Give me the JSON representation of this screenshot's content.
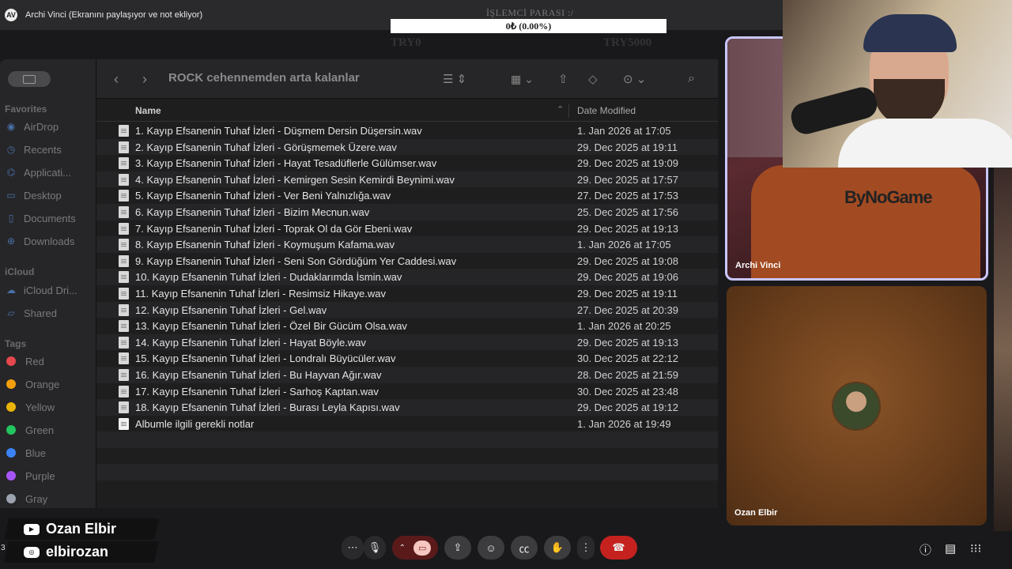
{
  "meeting": {
    "share_banner": "Archi Vinci (Ekranını paylaşıyor ve not ekliyor)",
    "logo_text": "AV"
  },
  "counter": {
    "title": "İŞLEMCİ PARASI :/",
    "value": "0₺ (0.00%)",
    "min": "TRY0",
    "max": "TRY5000"
  },
  "finder": {
    "title": "ROCK cehennemden arta kalanlar",
    "columns": {
      "name": "Name",
      "date": "Date Modified"
    },
    "sidebar": {
      "favorites_label": "Favorites",
      "favorites": [
        {
          "label": "AirDrop",
          "icon": "airdrop-icon"
        },
        {
          "label": "Recents",
          "icon": "clock-icon"
        },
        {
          "label": "Applicati...",
          "icon": "applications-icon"
        },
        {
          "label": "Desktop",
          "icon": "desktop-icon"
        },
        {
          "label": "Documents",
          "icon": "document-icon"
        },
        {
          "label": "Downloads",
          "icon": "download-icon"
        }
      ],
      "icloud_label": "iCloud",
      "icloud": [
        {
          "label": "iCloud Dri...",
          "icon": "cloud-icon"
        },
        {
          "label": "Shared",
          "icon": "shared-folder-icon"
        }
      ],
      "tags_label": "Tags",
      "tags": [
        {
          "label": "Red",
          "color": "#e5484d"
        },
        {
          "label": "Orange",
          "color": "#f59e0b"
        },
        {
          "label": "Yellow",
          "color": "#eab308"
        },
        {
          "label": "Green",
          "color": "#22c55e"
        },
        {
          "label": "Blue",
          "color": "#3b82f6"
        },
        {
          "label": "Purple",
          "color": "#a855f7"
        },
        {
          "label": "Gray",
          "color": "#9ca3af"
        }
      ]
    },
    "files": [
      {
        "name": "1. Kayıp Efsanenin Tuhaf İzleri - Düşmem Dersin Düşersin.wav",
        "date": "1. Jan 2026 at 17:05"
      },
      {
        "name": "2. Kayıp Efsanenin Tuhaf İzleri - Görüşmemek Üzere.wav",
        "date": "29. Dec 2025 at 19:11"
      },
      {
        "name": "3. Kayıp Efsanenin Tuhaf İzleri - Hayat Tesadüflerle Gülümser.wav",
        "date": "29. Dec 2025 at 19:09"
      },
      {
        "name": "4. Kayıp Efsanenin Tuhaf İzleri - Kemirgen Sesin Kemirdi Beynimi.wav",
        "date": "29. Dec 2025 at 17:57"
      },
      {
        "name": "5. Kayıp Efsanenin Tuhaf İzleri - Ver Beni Yalnızlığa.wav",
        "date": "27. Dec 2025 at 17:53"
      },
      {
        "name": "6. Kayıp Efsanenin Tuhaf İzleri - Bizim Mecnun.wav",
        "date": "25. Dec 2025 at 17:56"
      },
      {
        "name": "7. Kayıp Efsanenin Tuhaf İzleri - Toprak Ol da Gör Ebeni.wav",
        "date": "29. Dec 2025 at 19:13"
      },
      {
        "name": "8. Kayıp Efsanenin Tuhaf İzleri - Koymuşum Kafama.wav",
        "date": "1. Jan 2026 at 17:05"
      },
      {
        "name": "9. Kayıp Efsanenin Tuhaf İzleri - Seni Son Gördüğüm Yer Caddesi.wav",
        "date": "29. Dec 2025 at 19:08"
      },
      {
        "name": "10. Kayıp Efsanenin Tuhaf İzleri - Dudaklarımda İsmin.wav",
        "date": "29. Dec 2025 at 19:06"
      },
      {
        "name": "11. Kayıp Efsanenin Tuhaf İzleri - Resimsiz Hikaye.wav",
        "date": "29. Dec 2025 at 19:11"
      },
      {
        "name": "12. Kayıp Efsanenin Tuhaf İzleri - Gel.wav",
        "date": "27. Dec 2025 at 20:39"
      },
      {
        "name": "13. Kayıp Efsanenin Tuhaf İzleri - Özel Bir Gücüm Olsa.wav",
        "date": "1. Jan 2026 at 20:25"
      },
      {
        "name": "14. Kayıp Efsanenin Tuhaf İzleri - Hayat Böyle.wav",
        "date": "29. Dec 2025 at 19:13"
      },
      {
        "name": "15. Kayıp Efsanenin Tuhaf İzleri - Londralı Büyücüler.wav",
        "date": "30. Dec 2025 at 22:12"
      },
      {
        "name": "16. Kayıp Efsanenin Tuhaf İzleri - Bu Hayvan Ağır.wav",
        "date": "28. Dec 2025 at 21:59"
      },
      {
        "name": "17. Kayıp Efsanenin Tuhaf İzleri - Sarhoş Kaptan.wav",
        "date": "30. Dec 2025 at 23:48"
      },
      {
        "name": "18. Kayıp Efsanenin Tuhaf İzleri - Burası Leyla Kapısı.wav",
        "date": "29. Dec 2025 at 19:12"
      },
      {
        "name": "Albumle ilgili gerekli notlar",
        "date": "1. Jan 2026 at 19:49",
        "doc": true
      }
    ]
  },
  "participants": [
    {
      "name": "Archi Vinci",
      "overlay_text": "ByNoGame"
    },
    {
      "name": "Ozan Elbir"
    }
  ],
  "social": {
    "youtube": "Ozan Elbir",
    "instagram": "elbirozan",
    "page_number": "3"
  },
  "colors": {
    "active_speaker_border": "#c9c7ff",
    "hangup": "#c5221f"
  }
}
